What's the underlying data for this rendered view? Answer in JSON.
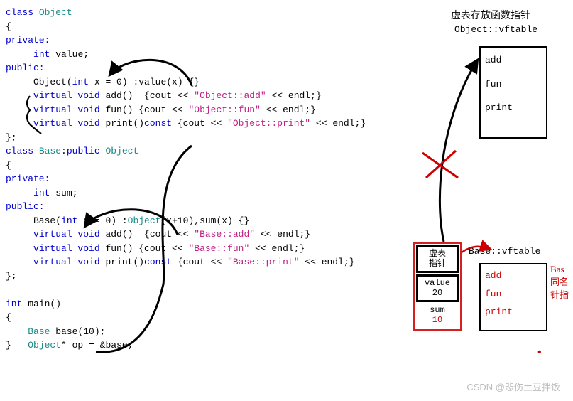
{
  "code": {
    "l01a": "class ",
    "l01b": "Object",
    "l02": "{",
    "l03": "private:",
    "l04a": "     ",
    "l04b": "int ",
    "l04c": "value;",
    "l05": "public:",
    "l06a": "     Object(",
    "l06b": "int ",
    "l06c": "x = 0) :value(x) {}",
    "l07a": "     ",
    "l07b": "virtual void ",
    "l07c": "add()  {cout << ",
    "l07d": "\"Object::add\"",
    "l07e": " << endl;}",
    "l08a": "     ",
    "l08b": "virtual void ",
    "l08c": "fun() {cout << ",
    "l08d": "\"Object::fun\"",
    "l08e": " << endl;}",
    "l09a": "     ",
    "l09b": "virtual void ",
    "l09c": "print()",
    "l09d": "const ",
    "l09e": "{cout << ",
    "l09f": "\"Object::print\"",
    "l09g": " << endl;}",
    "l10": "};",
    "l11a": "class ",
    "l11b": "Base",
    "l11c": ":",
    "l11d": "public ",
    "l11e": "Object",
    "l12": "{",
    "l13": "private:",
    "l14a": "     ",
    "l14b": "int ",
    "l14c": "sum;",
    "l15": "public:",
    "l16a": "     Base(",
    "l16b": "int ",
    "l16c": "x = 0) :",
    "l16d": "Object",
    "l16e": "(x+10),sum(x) {}",
    "l17a": "     ",
    "l17b": "virtual void ",
    "l17c": "add()  {cout << ",
    "l17d": "\"Base::add\"",
    "l17e": " << endl;}",
    "l18a": "     ",
    "l18b": "virtual void ",
    "l18c": "fun() {cout << ",
    "l18d": "\"Base::fun\"",
    "l18e": " << endl;}",
    "l19a": "     ",
    "l19b": "virtual void ",
    "l19c": "print()",
    "l19d": "const ",
    "l19e": "{cout << ",
    "l19f": "\"Base::print\"",
    "l19g": " << endl;}",
    "l20": "};",
    "l21": "",
    "l22a": "int ",
    "l22b": "main()",
    "l23": "{",
    "l24a": "    ",
    "l24b": "Base ",
    "l24c": "base(10);",
    "l25a": "}   ",
    "l25b": "Object",
    "l25c": "* op = &base;"
  },
  "right": {
    "title_cn": "虚表存放函数指针",
    "obj_vftable": "Object::vftable",
    "obj_methods": [
      "add",
      "fun",
      "print"
    ],
    "base_vftable": "Base::vftable",
    "base_methods": [
      "add",
      "fun",
      "print"
    ],
    "note_lines": [
      "Bas",
      "同名",
      "针指"
    ]
  },
  "mem": {
    "cell1": "虚表\n指针",
    "cell2_label": "value",
    "cell2_val": "20",
    "cell3_label": "sum",
    "cell3_val": "10"
  },
  "watermark": "CSDN @悲伤土豆拌饭"
}
